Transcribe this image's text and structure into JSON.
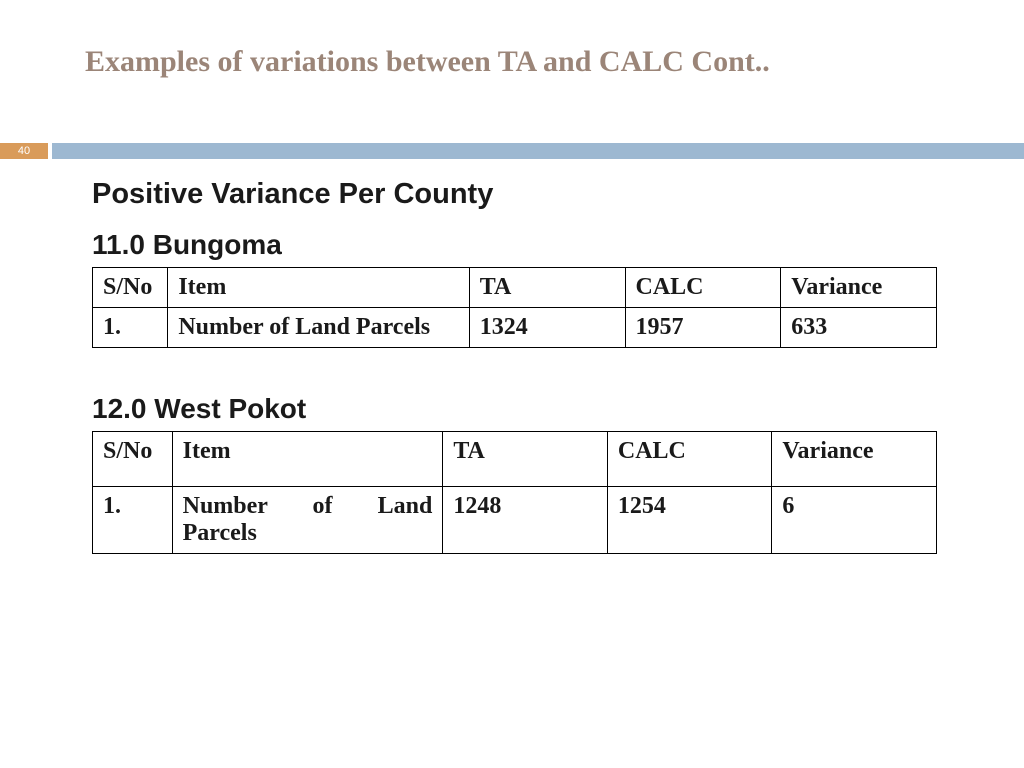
{
  "slide": {
    "title": "Examples of variations between TA and CALC Cont..",
    "pageNumber": "40"
  },
  "sectionTitle": "Positive Variance Per County",
  "counties": [
    {
      "heading": "11.0 Bungoma",
      "headers": {
        "sno": "S/No",
        "item": "Item",
        "ta": "TA",
        "calc": "CALC",
        "variance": "Variance"
      },
      "rows": [
        {
          "sno": "1.",
          "item": "Number of Land Parcels",
          "ta": "1324",
          "calc": "1957",
          "variance": "633"
        }
      ]
    },
    {
      "heading": "12.0 West Pokot",
      "headers": {
        "sno": "S/No",
        "item": "Item",
        "ta": "TA",
        "calc": "CALC",
        "variance": "Variance"
      },
      "rows": [
        {
          "sno": "1.",
          "item": "Number of Land Parcels",
          "ta": "1248",
          "calc": "1254",
          "variance": "6"
        }
      ]
    }
  ],
  "chart_data": {
    "type": "table",
    "title": "Positive Variance Per County — TA vs CALC",
    "series": [
      {
        "name": "Bungoma — Number of Land Parcels",
        "TA": 1324,
        "CALC": 1957,
        "Variance": 633
      },
      {
        "name": "West Pokot — Number of Land Parcels",
        "TA": 1248,
        "CALC": 1254,
        "Variance": 6
      }
    ]
  }
}
